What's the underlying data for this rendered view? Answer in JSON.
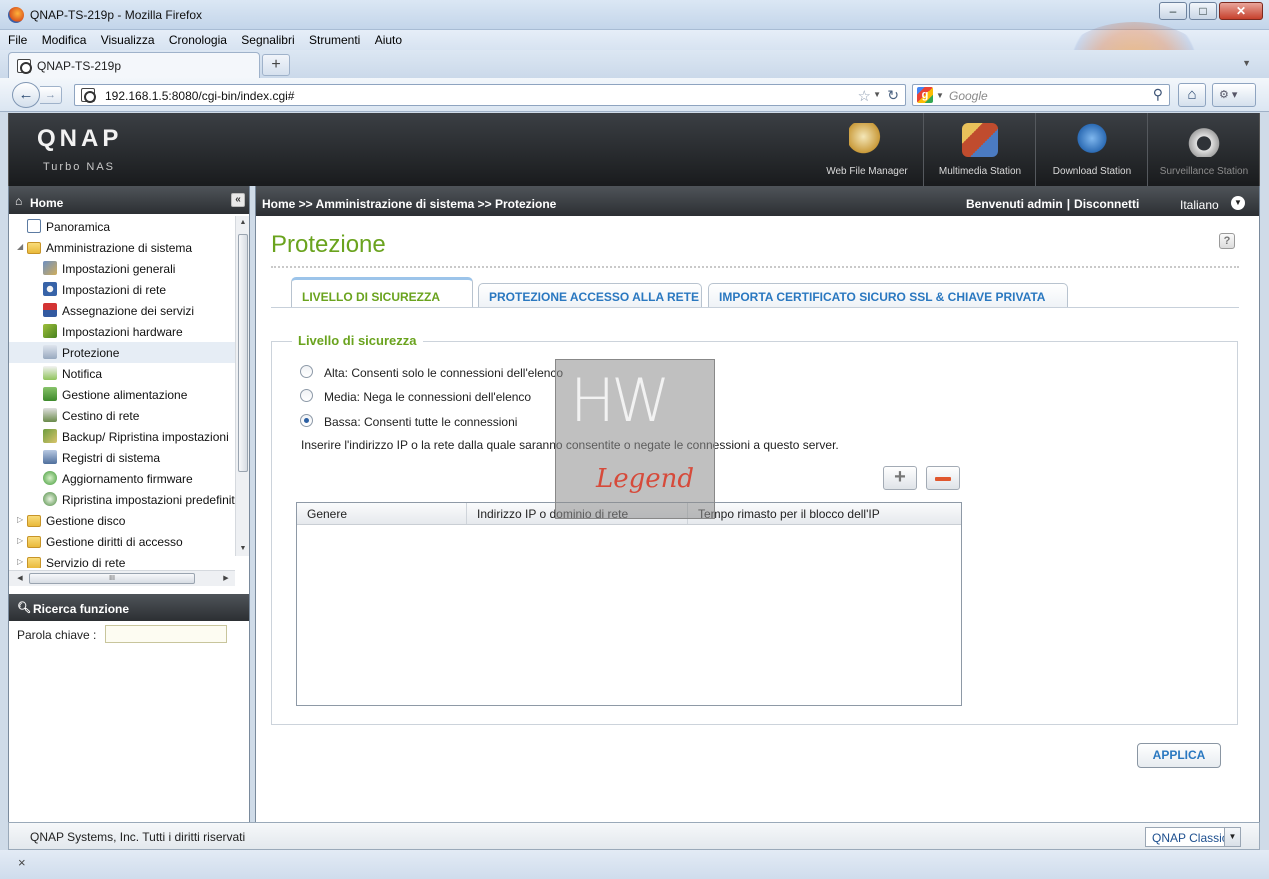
{
  "window": {
    "title": "QNAP-TS-219p - Mozilla Firefox",
    "minimize": "–",
    "maximize": "□",
    "close": "✕"
  },
  "menu": [
    "File",
    "Modifica",
    "Visualizza",
    "Cronologia",
    "Segnalibri",
    "Strumenti",
    "Aiuto"
  ],
  "browser_tab": {
    "label": "QNAP-TS-219p",
    "new_tab": "+"
  },
  "navigation": {
    "url": "192.168.1.5:8080/cgi-bin/index.cgi#",
    "search_placeholder": "Google",
    "search_engine_letter": "g"
  },
  "qnap": {
    "logo": "QNAP",
    "tagline": "Turbo NAS",
    "apps": [
      "Web File Manager",
      "Multimedia Station",
      "Download Station",
      "Surveillance Station"
    ]
  },
  "sidebar": {
    "title": "Home",
    "tree": [
      {
        "label": "Panoramica"
      },
      {
        "label": "Amministrazione di sistema"
      },
      {
        "label": "Impostazioni generali"
      },
      {
        "label": "Impostazioni di rete"
      },
      {
        "label": "Assegnazione dei servizi"
      },
      {
        "label": "Impostazioni hardware"
      },
      {
        "label": "Protezione"
      },
      {
        "label": "Notifica"
      },
      {
        "label": "Gestione alimentazione"
      },
      {
        "label": "Cestino di rete"
      },
      {
        "label": "Backup/ Ripristina impostazioni"
      },
      {
        "label": "Registri di sistema"
      },
      {
        "label": "Aggiornamento firmware"
      },
      {
        "label": "Ripristina impostazioni predefinite"
      },
      {
        "label": "Gestione disco"
      },
      {
        "label": "Gestione diritti di accesso"
      },
      {
        "label": "Servizio di rete"
      }
    ],
    "search_title": "Ricerca funzione",
    "keyword_label": "Parola chiave :",
    "scroll_grip": "III"
  },
  "header_bar": {
    "breadcrumb": "Home >> Amministrazione di sistema >> Protezione",
    "welcome": "Benvenuti admin",
    "logout": "Disconnetti",
    "language": "Italiano"
  },
  "content": {
    "title": "Protezione",
    "help": "?",
    "tabs": [
      "LIVELLO DI SICUREZZA",
      "PROTEZIONE ACCESSO ALLA RETE",
      "IMPORTA CERTIFICATO SICURO SSL & CHIAVE PRIVATA"
    ],
    "security_level": {
      "legend": "Livello di sicurezza",
      "options": [
        "Alta: Consenti solo le connessioni dell'elenco",
        "Media: Nega le connessioni dell'elenco",
        "Bassa: Consenti tutte le connessioni"
      ],
      "selected_index": 2,
      "info": "Inserire l'indirizzo IP o la rete dalla quale saranno consentite o negate le connessioni a questo server.",
      "add_label": "+",
      "columns": [
        "Genere",
        "Indirizzo IP o dominio di rete",
        "Tempo rimasto per il blocco dell'IP"
      ],
      "rows": []
    },
    "apply": "APPLICA"
  },
  "watermark": {
    "text_top": "HW",
    "text_bottom": "Legend"
  },
  "footer": {
    "copyright": "QNAP Systems, Inc. Tutti i diritti riservati",
    "theme": "QNAP Classic"
  },
  "statusbar": {
    "close": "×"
  },
  "colors": {
    "accent_green": "#6aa31e",
    "link_blue": "#2a78c0",
    "header_dark": "#2c2f33"
  }
}
